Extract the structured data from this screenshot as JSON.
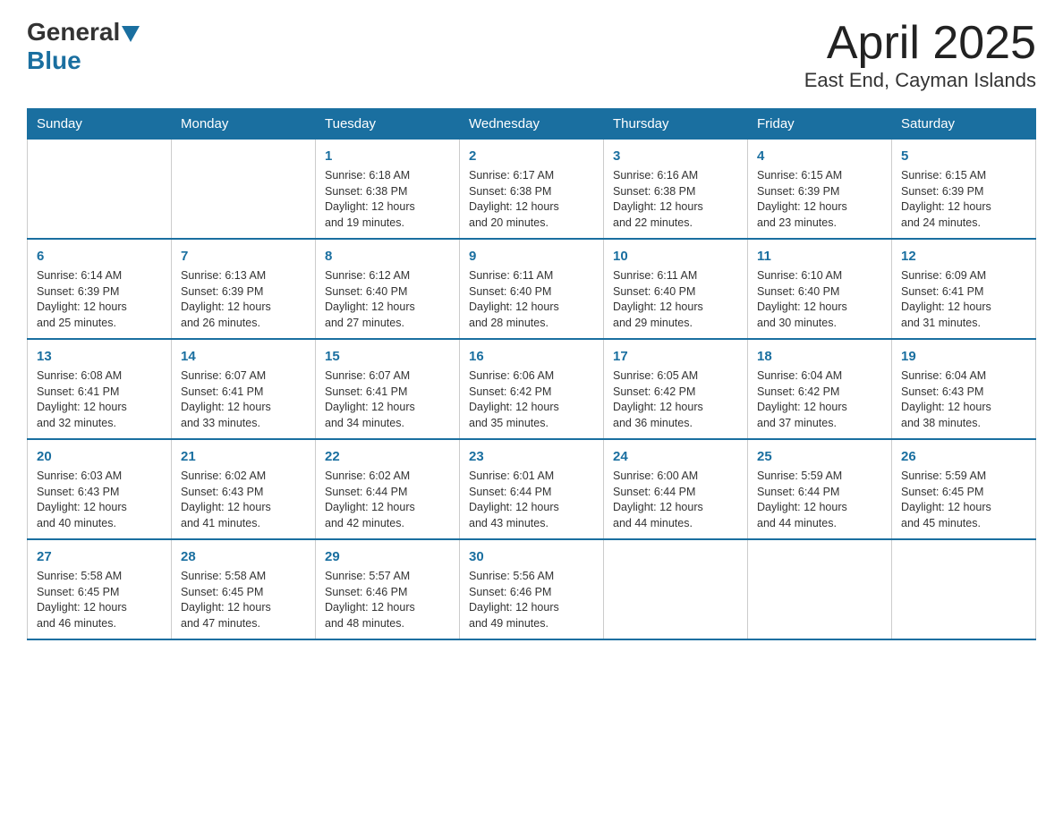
{
  "header": {
    "logo_general": "General",
    "logo_blue": "Blue",
    "month_title": "April 2025",
    "location": "East End, Cayman Islands"
  },
  "weekdays": [
    "Sunday",
    "Monday",
    "Tuesday",
    "Wednesday",
    "Thursday",
    "Friday",
    "Saturday"
  ],
  "weeks": [
    [
      {
        "day": "",
        "info": ""
      },
      {
        "day": "",
        "info": ""
      },
      {
        "day": "1",
        "info": "Sunrise: 6:18 AM\nSunset: 6:38 PM\nDaylight: 12 hours\nand 19 minutes."
      },
      {
        "day": "2",
        "info": "Sunrise: 6:17 AM\nSunset: 6:38 PM\nDaylight: 12 hours\nand 20 minutes."
      },
      {
        "day": "3",
        "info": "Sunrise: 6:16 AM\nSunset: 6:38 PM\nDaylight: 12 hours\nand 22 minutes."
      },
      {
        "day": "4",
        "info": "Sunrise: 6:15 AM\nSunset: 6:39 PM\nDaylight: 12 hours\nand 23 minutes."
      },
      {
        "day": "5",
        "info": "Sunrise: 6:15 AM\nSunset: 6:39 PM\nDaylight: 12 hours\nand 24 minutes."
      }
    ],
    [
      {
        "day": "6",
        "info": "Sunrise: 6:14 AM\nSunset: 6:39 PM\nDaylight: 12 hours\nand 25 minutes."
      },
      {
        "day": "7",
        "info": "Sunrise: 6:13 AM\nSunset: 6:39 PM\nDaylight: 12 hours\nand 26 minutes."
      },
      {
        "day": "8",
        "info": "Sunrise: 6:12 AM\nSunset: 6:40 PM\nDaylight: 12 hours\nand 27 minutes."
      },
      {
        "day": "9",
        "info": "Sunrise: 6:11 AM\nSunset: 6:40 PM\nDaylight: 12 hours\nand 28 minutes."
      },
      {
        "day": "10",
        "info": "Sunrise: 6:11 AM\nSunset: 6:40 PM\nDaylight: 12 hours\nand 29 minutes."
      },
      {
        "day": "11",
        "info": "Sunrise: 6:10 AM\nSunset: 6:40 PM\nDaylight: 12 hours\nand 30 minutes."
      },
      {
        "day": "12",
        "info": "Sunrise: 6:09 AM\nSunset: 6:41 PM\nDaylight: 12 hours\nand 31 minutes."
      }
    ],
    [
      {
        "day": "13",
        "info": "Sunrise: 6:08 AM\nSunset: 6:41 PM\nDaylight: 12 hours\nand 32 minutes."
      },
      {
        "day": "14",
        "info": "Sunrise: 6:07 AM\nSunset: 6:41 PM\nDaylight: 12 hours\nand 33 minutes."
      },
      {
        "day": "15",
        "info": "Sunrise: 6:07 AM\nSunset: 6:41 PM\nDaylight: 12 hours\nand 34 minutes."
      },
      {
        "day": "16",
        "info": "Sunrise: 6:06 AM\nSunset: 6:42 PM\nDaylight: 12 hours\nand 35 minutes."
      },
      {
        "day": "17",
        "info": "Sunrise: 6:05 AM\nSunset: 6:42 PM\nDaylight: 12 hours\nand 36 minutes."
      },
      {
        "day": "18",
        "info": "Sunrise: 6:04 AM\nSunset: 6:42 PM\nDaylight: 12 hours\nand 37 minutes."
      },
      {
        "day": "19",
        "info": "Sunrise: 6:04 AM\nSunset: 6:43 PM\nDaylight: 12 hours\nand 38 minutes."
      }
    ],
    [
      {
        "day": "20",
        "info": "Sunrise: 6:03 AM\nSunset: 6:43 PM\nDaylight: 12 hours\nand 40 minutes."
      },
      {
        "day": "21",
        "info": "Sunrise: 6:02 AM\nSunset: 6:43 PM\nDaylight: 12 hours\nand 41 minutes."
      },
      {
        "day": "22",
        "info": "Sunrise: 6:02 AM\nSunset: 6:44 PM\nDaylight: 12 hours\nand 42 minutes."
      },
      {
        "day": "23",
        "info": "Sunrise: 6:01 AM\nSunset: 6:44 PM\nDaylight: 12 hours\nand 43 minutes."
      },
      {
        "day": "24",
        "info": "Sunrise: 6:00 AM\nSunset: 6:44 PM\nDaylight: 12 hours\nand 44 minutes."
      },
      {
        "day": "25",
        "info": "Sunrise: 5:59 AM\nSunset: 6:44 PM\nDaylight: 12 hours\nand 44 minutes."
      },
      {
        "day": "26",
        "info": "Sunrise: 5:59 AM\nSunset: 6:45 PM\nDaylight: 12 hours\nand 45 minutes."
      }
    ],
    [
      {
        "day": "27",
        "info": "Sunrise: 5:58 AM\nSunset: 6:45 PM\nDaylight: 12 hours\nand 46 minutes."
      },
      {
        "day": "28",
        "info": "Sunrise: 5:58 AM\nSunset: 6:45 PM\nDaylight: 12 hours\nand 47 minutes."
      },
      {
        "day": "29",
        "info": "Sunrise: 5:57 AM\nSunset: 6:46 PM\nDaylight: 12 hours\nand 48 minutes."
      },
      {
        "day": "30",
        "info": "Sunrise: 5:56 AM\nSunset: 6:46 PM\nDaylight: 12 hours\nand 49 minutes."
      },
      {
        "day": "",
        "info": ""
      },
      {
        "day": "",
        "info": ""
      },
      {
        "day": "",
        "info": ""
      }
    ]
  ]
}
